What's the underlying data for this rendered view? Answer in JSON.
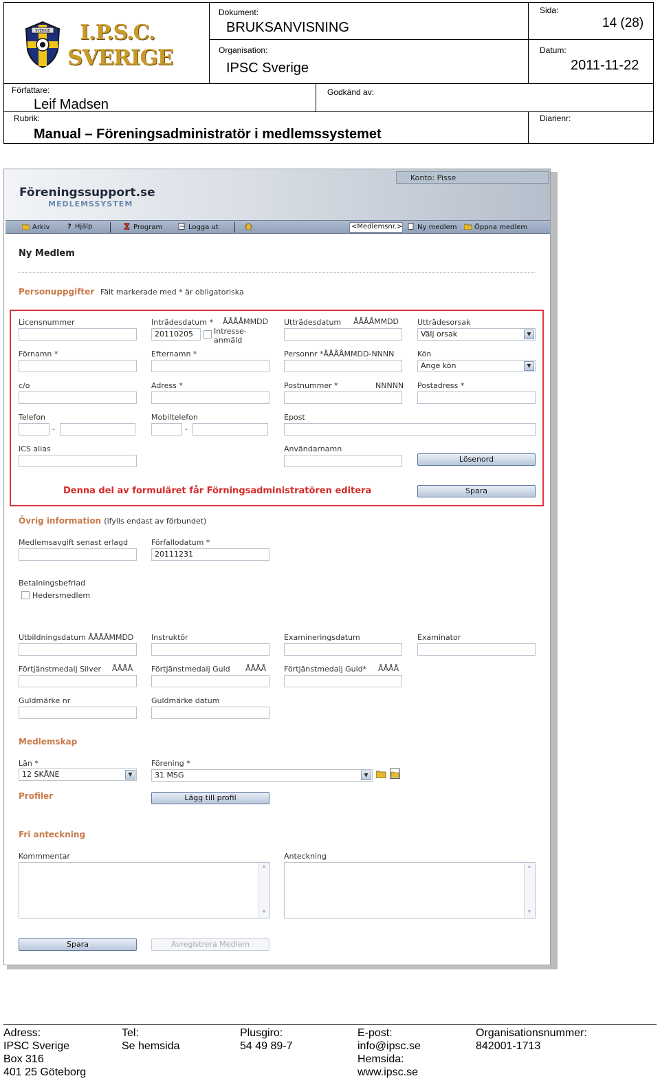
{
  "doc_header": {
    "logo_text_line1": "I.P.S.C.",
    "logo_text_line2": "SVERIGE",
    "logo_shield_text": "SVERIGE",
    "dokument_label": "Dokument:",
    "dokument_value": "BRUKSANVISNING",
    "sida_label": "Sida:",
    "sida_value": "14 (28)",
    "organisation_label": "Organisation:",
    "organisation_value": "IPSC Sverige",
    "datum_label": "Datum:",
    "datum_value": "2011-11-22",
    "forfattare_label": "Författare:",
    "forfattare_value": "Leif Madsen",
    "godkand_label": "Godkänd av:",
    "rubrik_label": "Rubrik:",
    "rubrik_value": "Manual – Föreningsadministratör i medlemssystemet",
    "diarienr_label": "Diarienr:"
  },
  "app": {
    "brand": "Föreningssupport.se",
    "brand_sub": "MEDLEMSSYSTEM",
    "account": "Konto: Pisse",
    "menu": {
      "arkiv": "Arkiv",
      "hjalp": "Hjälp",
      "program": "Program",
      "logga_ut": "Logga ut",
      "member_no_placeholder": "<Medlemsnr.>",
      "ny_medlem": "Ny medlem",
      "oppna_medlem": "Öppna medlem"
    },
    "page_title": "Ny Medlem",
    "personuppgifter": {
      "heading": "Personuppgifter",
      "note": "Fält markerade med * är obligatoriska",
      "licensnummer": "Licensnummer",
      "intradesdatum": "Inträdesdatum *",
      "intradesdatum_format": "ÅÅÅÅMMDD",
      "intradesdatum_value": "20110205",
      "intresse_line1": "Intresse-",
      "intresse_line2": "anmäld",
      "utradesdatum": "Utträdesdatum",
      "utradesdatum_format": "ÅÅÅÅMMDD",
      "utradesorsak": "Utträdesorsak",
      "utradesorsak_value": "Välj orsak",
      "fornamn": "Förnamn *",
      "efternamn": "Efternamn *",
      "personnr": "Personnr *ÅÅÅÅMMDD-NNNN",
      "kon": "Kön",
      "kon_value": "Ange kön",
      "co": "c/o",
      "adress": "Adress *",
      "postnummer": "Postnummer *",
      "postnummer_format": "NNNNN",
      "postadress": "Postadress *",
      "telefon": "Telefon",
      "mobiltelefon": "Mobiltelefon",
      "epost": "Epost",
      "dash": "-",
      "ics_alias": "ICS alias",
      "anvandarnamn": "Användarnamn",
      "losenord_btn": "Lösenord",
      "notice": "Denna del av formuläret får Förningsadministratören editera",
      "spara_btn": "Spara"
    },
    "ovrig": {
      "heading": "Övrig information",
      "heading_note": "(ifylls endast av förbundet)",
      "medlemsavgift": "Medlemsavgift senast erlagd",
      "forfallodatum": "Förfallodatum *",
      "forfallodatum_value": "20111231",
      "betalningsbefriad": "Betalningsbefriad",
      "hedersmedlem": "Hedersmedlem",
      "utbildningsdatum": "Utbildningsdatum ÅÅÅÅMMDD",
      "instruktor": "Instruktör",
      "examineringsdatum": "Examineringsdatum",
      "examinator": "Examinator",
      "silver": "Förtjänstmedalj Silver",
      "silver_format": "ÅÅÅÅ",
      "guld": "Förtjänstmedalj Guld",
      "guld_format": "ÅÅÅÅ",
      "guld_star": "Förtjänstmedalj Guld*",
      "guld_star_format": "ÅÅÅÅ",
      "guldmarke_nr": "Guldmärke nr",
      "guldmarke_datum": "Guldmärke datum"
    },
    "medlemskap": {
      "heading": "Medlemskap",
      "lan": "Län *",
      "lan_value": "12 SKÅNE",
      "forening": "Förening *",
      "forening_value": "31 MSG"
    },
    "profiler": {
      "heading": "Profiler",
      "add_btn": "Lägg till profil"
    },
    "anteckning": {
      "heading": "Fri anteckning",
      "kommentar": "Kommmentar",
      "anteckning": "Anteckning"
    },
    "footer_buttons": {
      "spara": "Spara",
      "avregistrera": "Avregistrera Medlem"
    }
  },
  "doc_footer": {
    "adress_label": "Adress:",
    "adress_1": "IPSC Sverige",
    "adress_2": "Box 316",
    "adress_3": "401 25 Göteborg",
    "tel_label": "Tel:",
    "tel_value": "Se hemsida",
    "plusgiro_label": "Plusgiro:",
    "plusgiro_value": "54 49 89-7",
    "epost_label": "E-post:",
    "epost_value": "info@ipsc.se",
    "hemsida_label": "Hemsida:",
    "hemsida_value": "www.ipsc.se",
    "orgnr_label": "Organisationsnummer:",
    "orgnr_value": "842001-1713"
  },
  "colors": {
    "red_border": "#e1353a",
    "notice_red": "#d42a2a",
    "section_orange": "#c87a4a",
    "logo_gold": "#c89a2a"
  }
}
